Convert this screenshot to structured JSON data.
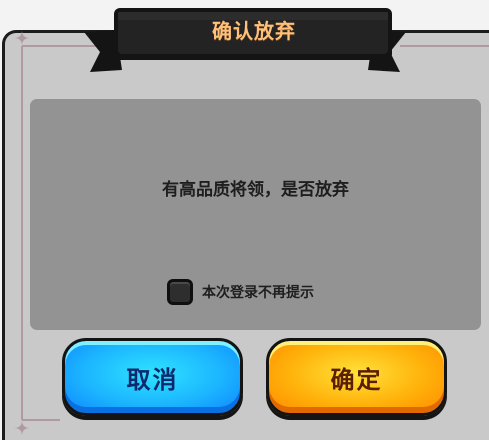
{
  "dialog": {
    "title": "确认放弃",
    "message": "有高品质将领，是否放弃",
    "checkbox": {
      "label": "本次登录不再提示",
      "checked": false
    },
    "buttons": {
      "cancel_label": "取消",
      "confirm_label": "确定"
    }
  },
  "colors": {
    "panel": "#c9c9c9",
    "content_box": "#939393",
    "title_text": "#ffc07a",
    "cancel_button": "#1cb6ff",
    "confirm_button": "#ffb20a",
    "banner": "#222222"
  }
}
